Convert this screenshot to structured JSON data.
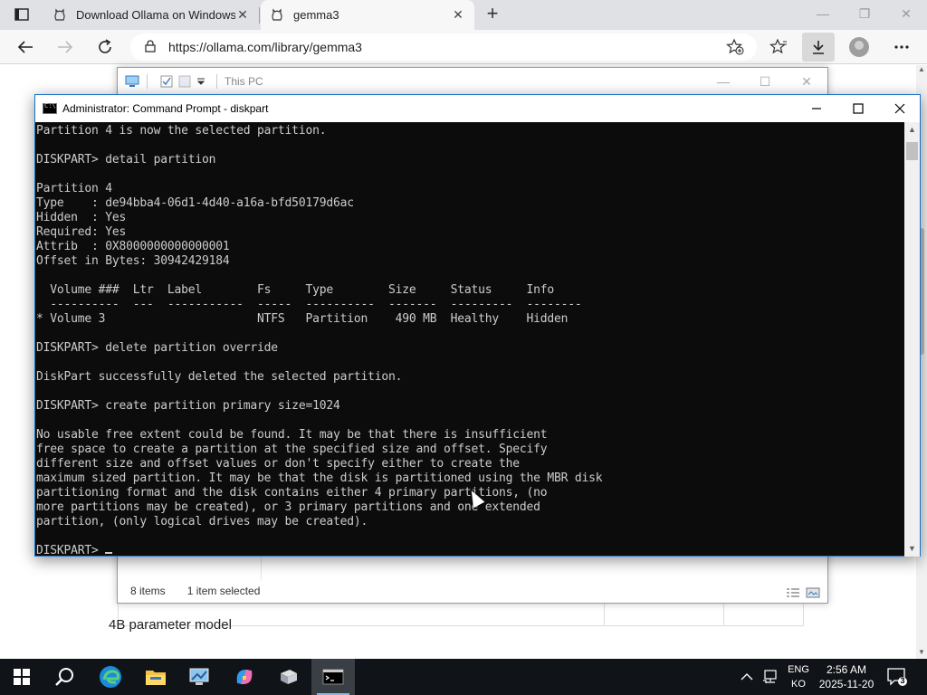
{
  "browser": {
    "tabs": [
      {
        "title": "Download Ollama on Windows"
      },
      {
        "title": "gemma3"
      }
    ],
    "url": "https://ollama.com/library/gemma3"
  },
  "page": {
    "visible_text": "4B parameter model"
  },
  "explorer": {
    "title": "This PC",
    "status_items": "8 items",
    "status_selected": "1 item selected"
  },
  "cmd": {
    "title": "Administrator: Command Prompt - diskpart",
    "lines": [
      "Partition 4 is now the selected partition.",
      "",
      "DISKPART> detail partition",
      "",
      "Partition 4",
      "Type    : de94bba4-06d1-4d40-a16a-bfd50179d6ac",
      "Hidden  : Yes",
      "Required: Yes",
      "Attrib  : 0X8000000000000001",
      "Offset in Bytes: 30942429184",
      "",
      "  Volume ###  Ltr  Label        Fs     Type        Size     Status     Info",
      "  ----------  ---  -----------  -----  ----------  -------  ---------  --------",
      "* Volume 3                      NTFS   Partition    490 MB  Healthy    Hidden",
      "",
      "DISKPART> delete partition override",
      "",
      "DiskPart successfully deleted the selected partition.",
      "",
      "DISKPART> create partition primary size=1024",
      "",
      "No usable free extent could be found. It may be that there is insufficient",
      "free space to create a partition at the specified size and offset. Specify",
      "different size and offset values or don't specify either to create the",
      "maximum sized partition. It may be that the disk is partitioned using the MBR disk",
      "partitioning format and the disk contains either 4 primary partitions, (no",
      "more partitions may be created), or 3 primary partitions and one extended",
      "partition, (only logical drives may be created).",
      ""
    ],
    "prompt": "DISKPART> "
  },
  "taskbar": {
    "lang_top": "ENG",
    "lang_bottom": "KO",
    "time": "2:56 AM",
    "date": "2025-11-20",
    "notification_count": "3",
    "accent": "#8fb4e8"
  }
}
